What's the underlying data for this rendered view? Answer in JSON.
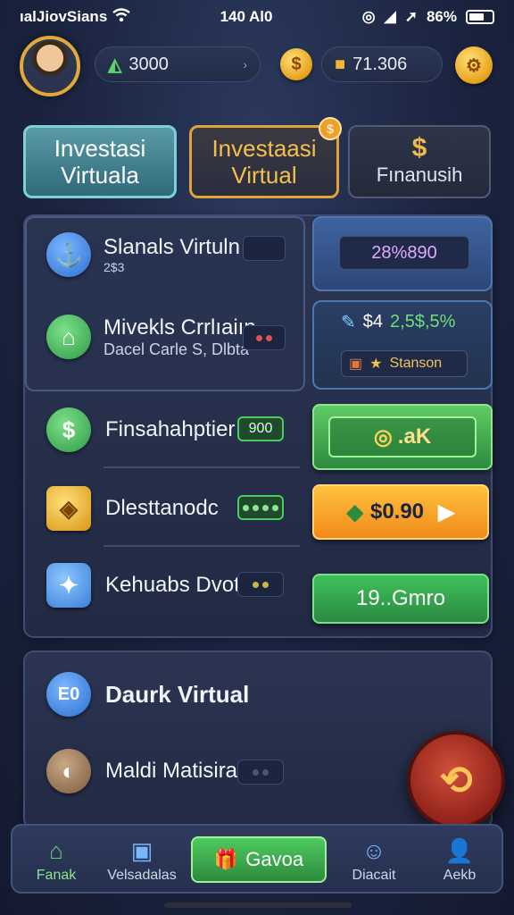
{
  "status_bar": {
    "carrier": "ıalJiovSians",
    "time": "140 Al0",
    "battery": "86%"
  },
  "header": {
    "balance_1": "3000",
    "balance_2": "71.306",
    "coin_symbol": "$"
  },
  "tabs": [
    {
      "label_line1": "Investasi",
      "label_line2": "Virtuala"
    },
    {
      "label_line1": "Investaasi",
      "label_line2": "Virtual",
      "badge": "$"
    },
    {
      "icon": "$",
      "label": "Fınanusih"
    }
  ],
  "main": {
    "rows": [
      {
        "title": "Slanals Virtuln",
        "sub": "2$3"
      },
      {
        "title": "Mivekls Crrlıaiın",
        "sub": "Dacel Carle S, Dlbta"
      },
      {
        "title": "Finsahahptier",
        "chip": "900"
      },
      {
        "title": "Dlesttanodc"
      },
      {
        "title": "Kehuabs Dvota"
      }
    ],
    "side_card_1_value": "28%890",
    "side_card_2_line": "$4 2,5$,5%",
    "side_card_2_line_prefix": "$4",
    "side_card_2_line_value": "2,5$,5%",
    "side_card_2_tag": "Stanson",
    "button_green_1": ".aK",
    "button_orange": "$0.90",
    "button_green_2": "19..Gmro"
  },
  "bottom_panel": {
    "title": "Daurk Virtual",
    "item": "Maldi Matisira",
    "icon_text": "E0"
  },
  "nav": [
    {
      "label": "Fanak",
      "icon": "home-icon"
    },
    {
      "label": "Velsadalas",
      "icon": "chat-icon"
    },
    {
      "label": "Gavoa",
      "icon": "gift-icon"
    },
    {
      "label": "Diacait",
      "icon": "group-icon"
    },
    {
      "label": "Aekb",
      "icon": "user-icon"
    }
  ],
  "colors": {
    "accent_green": "#4ecb5e",
    "accent_gold": "#f0a02a",
    "panel_bg": "#2b3552"
  }
}
